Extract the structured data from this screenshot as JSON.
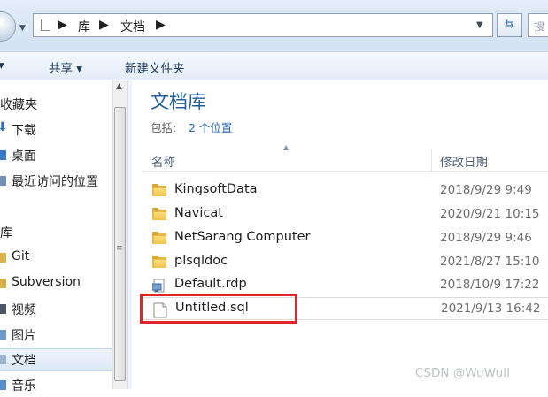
{
  "address_bar": {
    "crumbs": [
      "库",
      "文档"
    ],
    "separator": "▶",
    "search_placeholder": "搜"
  },
  "toolbar": {
    "share_label": "共享 ▾",
    "new_folder_label": "新建文件夹"
  },
  "nav": {
    "favorites_label": "收藏夹",
    "items_favorites": [
      {
        "label": "下载",
        "icon": "download-icon"
      },
      {
        "label": "桌面",
        "icon": "desktop-icon"
      },
      {
        "label": "最近访问的位置",
        "icon": "recent-places-icon"
      }
    ],
    "libraries_label": "库",
    "items_libraries": [
      {
        "label": "Git",
        "icon": "folder-icon"
      },
      {
        "label": "Subversion",
        "icon": "folder-icon"
      },
      {
        "label": "视频",
        "icon": "video-library-icon"
      },
      {
        "label": "图片",
        "icon": "pictures-library-icon"
      },
      {
        "label": "文档",
        "icon": "documents-library-icon"
      },
      {
        "label": "音乐",
        "icon": "music-library-icon"
      }
    ]
  },
  "main": {
    "library_title": "文档库",
    "includes_label": "包括:",
    "includes_link": "2 个位置",
    "columns": {
      "name": "名称",
      "modified": "修改日期"
    },
    "files": [
      {
        "name": "KingsoftData",
        "date": "2018/9/29 9:49",
        "icon": "folder-icon"
      },
      {
        "name": "Navicat",
        "date": "2020/9/21 10:15",
        "icon": "folder-icon"
      },
      {
        "name": "NetSarang Computer",
        "date": "2018/9/29 9:46",
        "icon": "folder-icon"
      },
      {
        "name": "plsqldoc",
        "date": "2021/8/27 15:10",
        "icon": "folder-icon"
      },
      {
        "name": "Default.rdp",
        "date": "2018/10/9 17:22",
        "icon": "rdp-file-icon"
      },
      {
        "name": "Untitled.sql",
        "date": "2021/9/13 16:42",
        "icon": "document-file-icon"
      }
    ]
  },
  "watermark": "CSDN @WuWuII",
  "colors": {
    "accent": "#1f5d9c",
    "highlight": "#e1262b",
    "link": "#2866b0"
  }
}
